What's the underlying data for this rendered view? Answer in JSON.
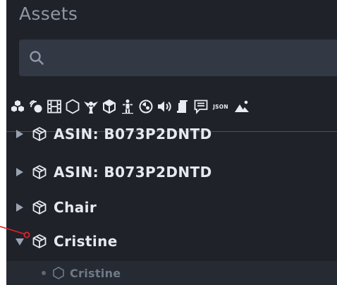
{
  "panel": {
    "title": "Assets"
  },
  "search": {
    "placeholder": "",
    "value": ""
  },
  "filters": [
    "materials-icon",
    "lights-icon",
    "video-icon",
    "meshes-icon",
    "effects-icon",
    "models-icon",
    "characters-icon",
    "environments-icon",
    "audio-icon",
    "scripts-icon",
    "text-icon",
    "json-icon",
    "scenes-icon"
  ],
  "json_label": "JSON",
  "tree": {
    "rows": [
      {
        "label": "ASIN: B073P2DNTD"
      },
      {
        "label": "ASIN: B073P2DNTD"
      },
      {
        "label": "Chair"
      },
      {
        "label": "Cristine"
      }
    ],
    "child": {
      "label": "Cristine"
    }
  },
  "colors": {
    "panel_bg": "#1f2229",
    "search_bg": "#323844",
    "text": "#e6eaf0",
    "muted": "#6f7a88",
    "callout": "#e0202a"
  }
}
